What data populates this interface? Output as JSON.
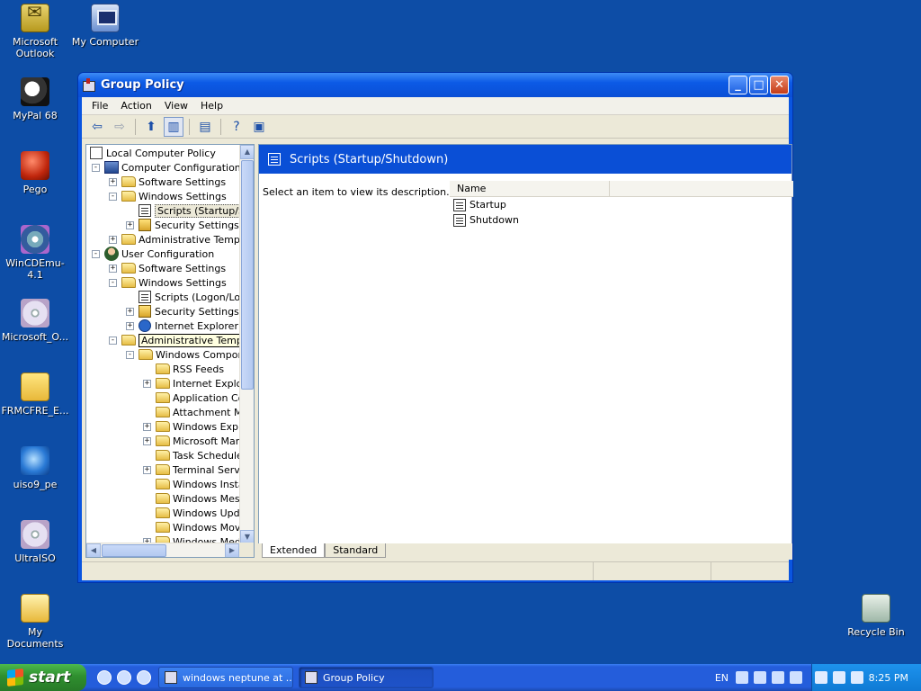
{
  "desktop": {
    "icons": [
      {
        "label": "Microsoft Outlook"
      },
      {
        "label": "My Computer"
      },
      {
        "label": "MyPal 68"
      },
      {
        "label": "Pego"
      },
      {
        "label": "WinCDEmu-4.1"
      },
      {
        "label": "Microsoft_O..."
      },
      {
        "label": "FRMCFRE_E..."
      },
      {
        "label": "uiso9_pe"
      },
      {
        "label": "UltraISO"
      },
      {
        "label": "My Documents"
      },
      {
        "label": "Recycle Bin"
      }
    ]
  },
  "window": {
    "title": "Group Policy",
    "menu": [
      "File",
      "Action",
      "View",
      "Help"
    ],
    "tree": {
      "root": "Local Computer Policy",
      "items": [
        "Computer Configuration",
        "Software Settings",
        "Windows Settings",
        "Scripts (Startup/Shu",
        "Security Settings",
        "Administrative Template",
        "User Configuration",
        "Software Settings",
        "Windows Settings",
        "Scripts (Logon/Logo",
        "Security Settings",
        "Internet Explorer M",
        "Administrative Templates",
        "Windows Componer",
        "RSS Feeds",
        "Internet Explor",
        "Application Com",
        "Attachment Ma",
        "Windows Explor",
        "Microsoft Mana",
        "Task Scheduler",
        "Terminal Servic",
        "Windows Instal",
        "Windows Messe",
        "Windows Updat",
        "Windows Movie",
        "Windows Media"
      ]
    },
    "detail": {
      "header": "Scripts (Startup/Shutdown)",
      "description": "Select an item to view its description.",
      "column_name": "Name",
      "items": [
        "Startup",
        "Shutdown"
      ],
      "tabs": [
        "Extended",
        "Standard"
      ]
    }
  },
  "taskbar": {
    "start_label": "start",
    "tasks": [
      "windows neptune at ...",
      "Group Policy"
    ],
    "language": "EN",
    "time": "8:25 PM"
  }
}
